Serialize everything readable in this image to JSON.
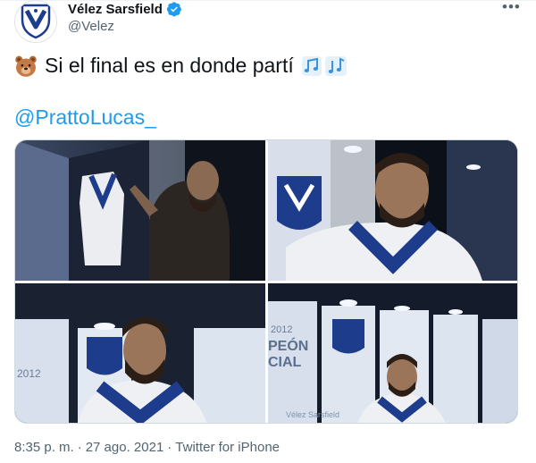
{
  "account": {
    "name": "Vélez Sarsfield",
    "handle": "@Velez",
    "verified_color": "#1d9bf0"
  },
  "tweet": {
    "emoji_icon": "bear-face-icon",
    "text": "Si el final es en donde partí",
    "notes_icon": "musical-notes-icon",
    "mention": "@PrattoLucas_"
  },
  "media": {
    "count": 4,
    "locker_text_1": "2012",
    "locker_text_2": "PEÓN",
    "locker_text_3": "CIAL",
    "locker_text_4": "Vélez Sarsfield"
  },
  "meta": {
    "time": "8:35 p. m.",
    "sep1": "·",
    "date": "27 ago. 2021",
    "sep2": "·",
    "source": "Twitter for iPhone"
  },
  "colors": {
    "accent": "#1d9bf0",
    "text": "#0f1419",
    "muted": "#536471",
    "velez_blue": "#1e3c8c"
  }
}
